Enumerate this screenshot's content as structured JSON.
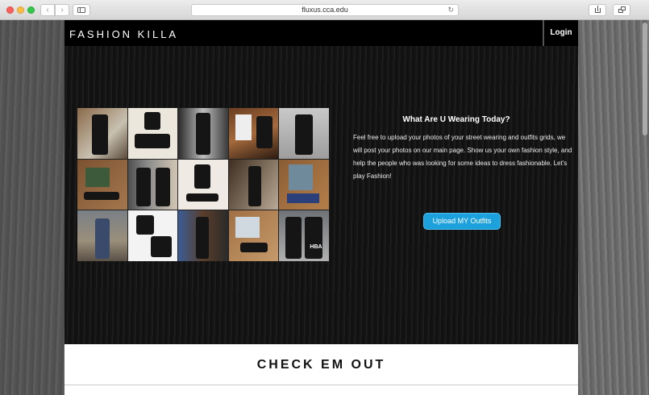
{
  "browser": {
    "url": "fluxus.cca.edu",
    "back_glyph": "‹",
    "forward_glyph": "›",
    "reload_glyph": "↻"
  },
  "header": {
    "brand": "FASHION KILLA",
    "login_label": "Login"
  },
  "hero": {
    "title": "What Are U Wearing Today?",
    "description": "Feel free to upload your photos of your street wearing and outfits grids, we will post your photos on our main page. Show us your own fashion style, and help the people who was looking for some ideas to dress fashionable. Let's play Fashion!",
    "upload_label": "Upload MY Outfits",
    "collage_tag": "HBA"
  },
  "section": {
    "heading": "CHECK EM OUT"
  },
  "colors": {
    "accent": "#1da1dc",
    "header_bg": "#000000",
    "hero_bg": "#151515"
  }
}
